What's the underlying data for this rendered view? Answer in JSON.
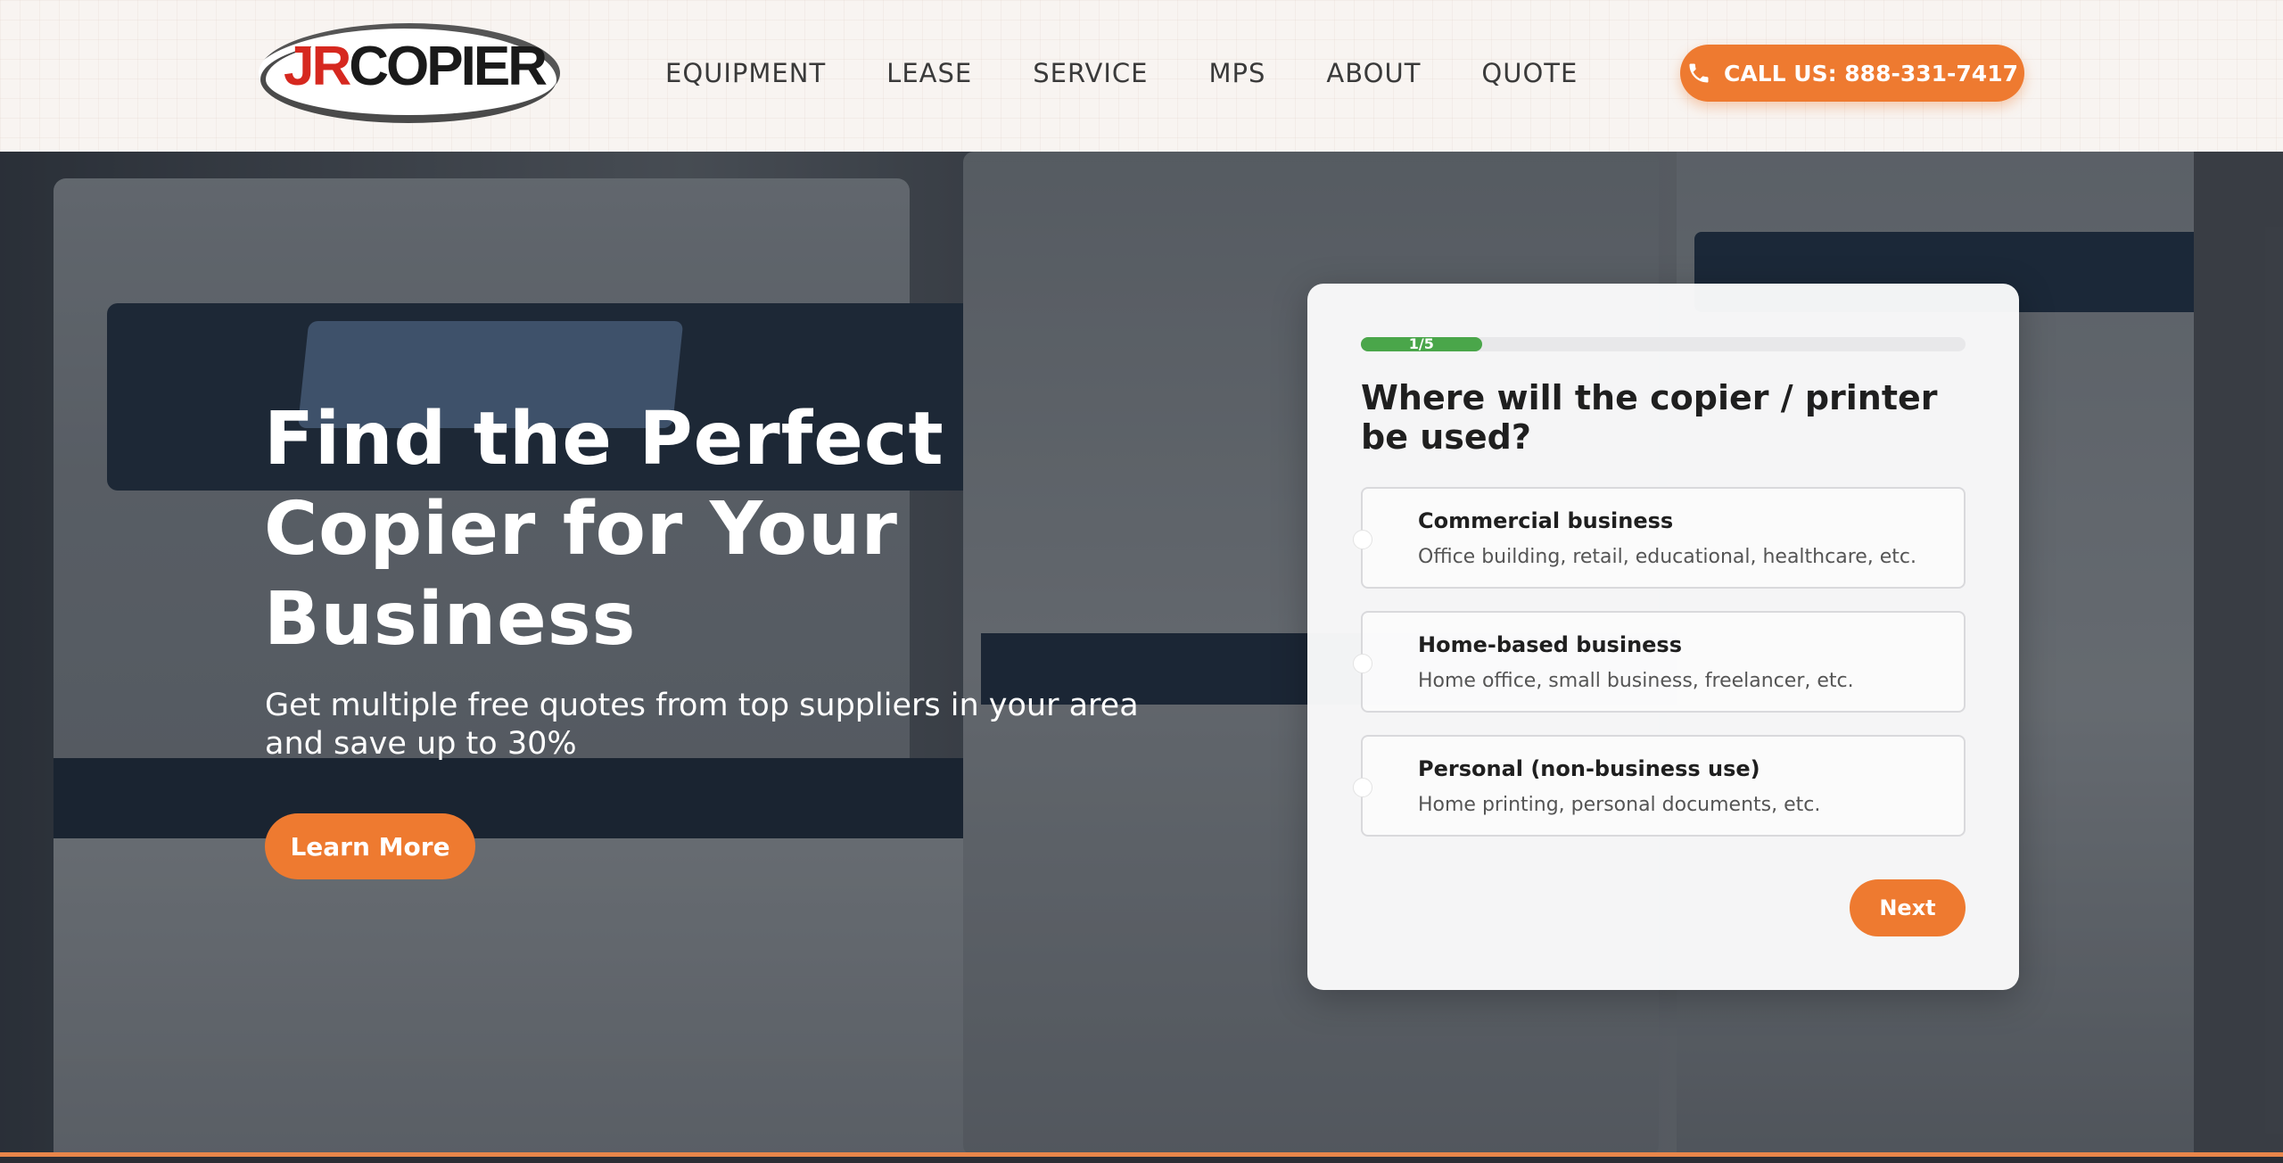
{
  "header": {
    "logo": {
      "part1": "JR",
      "part2": "COPIER"
    },
    "nav": [
      "EQUIPMENT",
      "LEASE",
      "SERVICE",
      "MPS",
      "ABOUT",
      "QUOTE"
    ],
    "call_button": "CALL US: 888-331-7417"
  },
  "hero": {
    "title": "Find the Perfect Copier for Your Business",
    "subtitle": "Get multiple free quotes from top suppliers in your area and save up to 30%",
    "cta": "Learn More"
  },
  "quiz": {
    "progress_label": "1/5",
    "progress_fraction": 0.2,
    "question": "Where will the copier / printer be used?",
    "options": [
      {
        "title": "Commercial business",
        "desc": "Office building, retail, educational, healthcare, etc."
      },
      {
        "title": "Home-based business",
        "desc": "Home office, small business, freelancer, etc."
      },
      {
        "title": "Personal (non-business use)",
        "desc": "Home printing, personal documents, etc."
      }
    ],
    "next": "Next"
  },
  "colors": {
    "accent": "#ee7a30",
    "progress": "#4aa64a",
    "logo_red": "#d6281f"
  },
  "icons": {
    "call": "phone-icon"
  }
}
